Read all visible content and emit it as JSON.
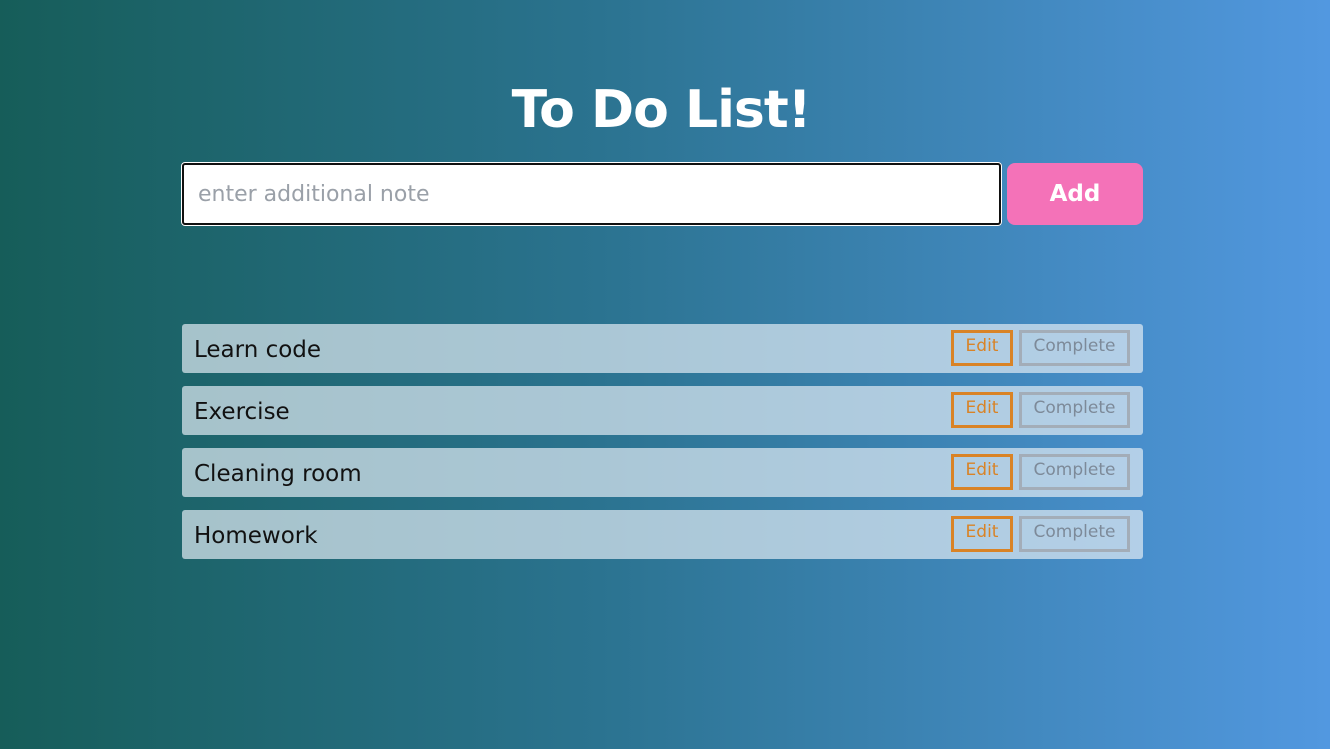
{
  "page": {
    "title": "To Do List!"
  },
  "form": {
    "input_value": "",
    "input_placeholder": "enter additional note",
    "add_label": "Add"
  },
  "todos": [
    {
      "text": "Learn code",
      "edit_label": "Edit",
      "complete_label": "Complete"
    },
    {
      "text": "Exercise",
      "edit_label": "Edit",
      "complete_label": "Complete"
    },
    {
      "text": "Cleaning room",
      "edit_label": "Edit",
      "complete_label": "Complete"
    },
    {
      "text": "Homework",
      "edit_label": "Edit",
      "complete_label": "Complete"
    }
  ],
  "colors": {
    "background_start": "#165d59",
    "background_end": "#5298e0",
    "add_button": "#f472b8",
    "edit_accent": "#d98326",
    "complete_accent": "#a3adb8"
  }
}
